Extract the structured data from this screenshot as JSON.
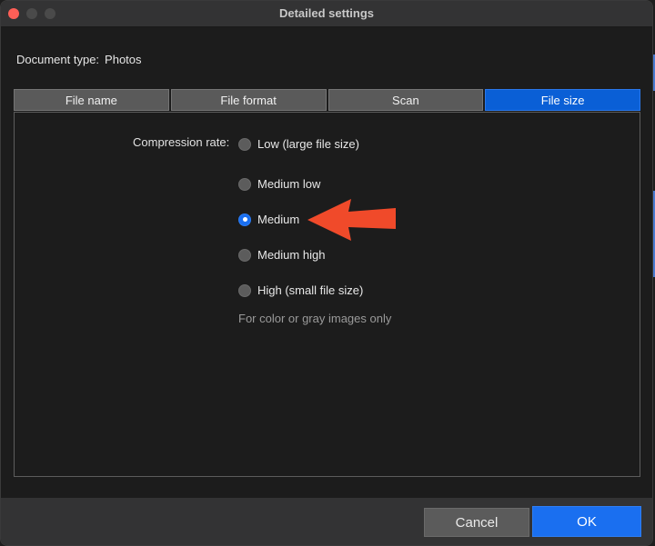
{
  "window": {
    "title": "Detailed settings"
  },
  "document_type": {
    "label": "Document type:",
    "value": "Photos"
  },
  "tabs": [
    {
      "label": "File name",
      "active": false
    },
    {
      "label": "File format",
      "active": false
    },
    {
      "label": "Scan",
      "active": false
    },
    {
      "label": "File size",
      "active": true
    }
  ],
  "compression": {
    "label": "Compression rate:",
    "options": [
      {
        "label": "Low (large file size)",
        "selected": false
      },
      {
        "label": "Medium low",
        "selected": false
      },
      {
        "label": "Medium",
        "selected": true
      },
      {
        "label": "Medium high",
        "selected": false
      },
      {
        "label": "High (small file size)",
        "selected": false
      }
    ],
    "note": "For color or gray images only"
  },
  "buttons": {
    "cancel": "Cancel",
    "ok": "OK"
  },
  "colors": {
    "accent": "#1a6ff0",
    "annotation_arrow": "#f04a2a",
    "close_button": "#fe5f57"
  },
  "annotation": {
    "icon": "red-arrow-icon",
    "points_to": "Medium"
  }
}
